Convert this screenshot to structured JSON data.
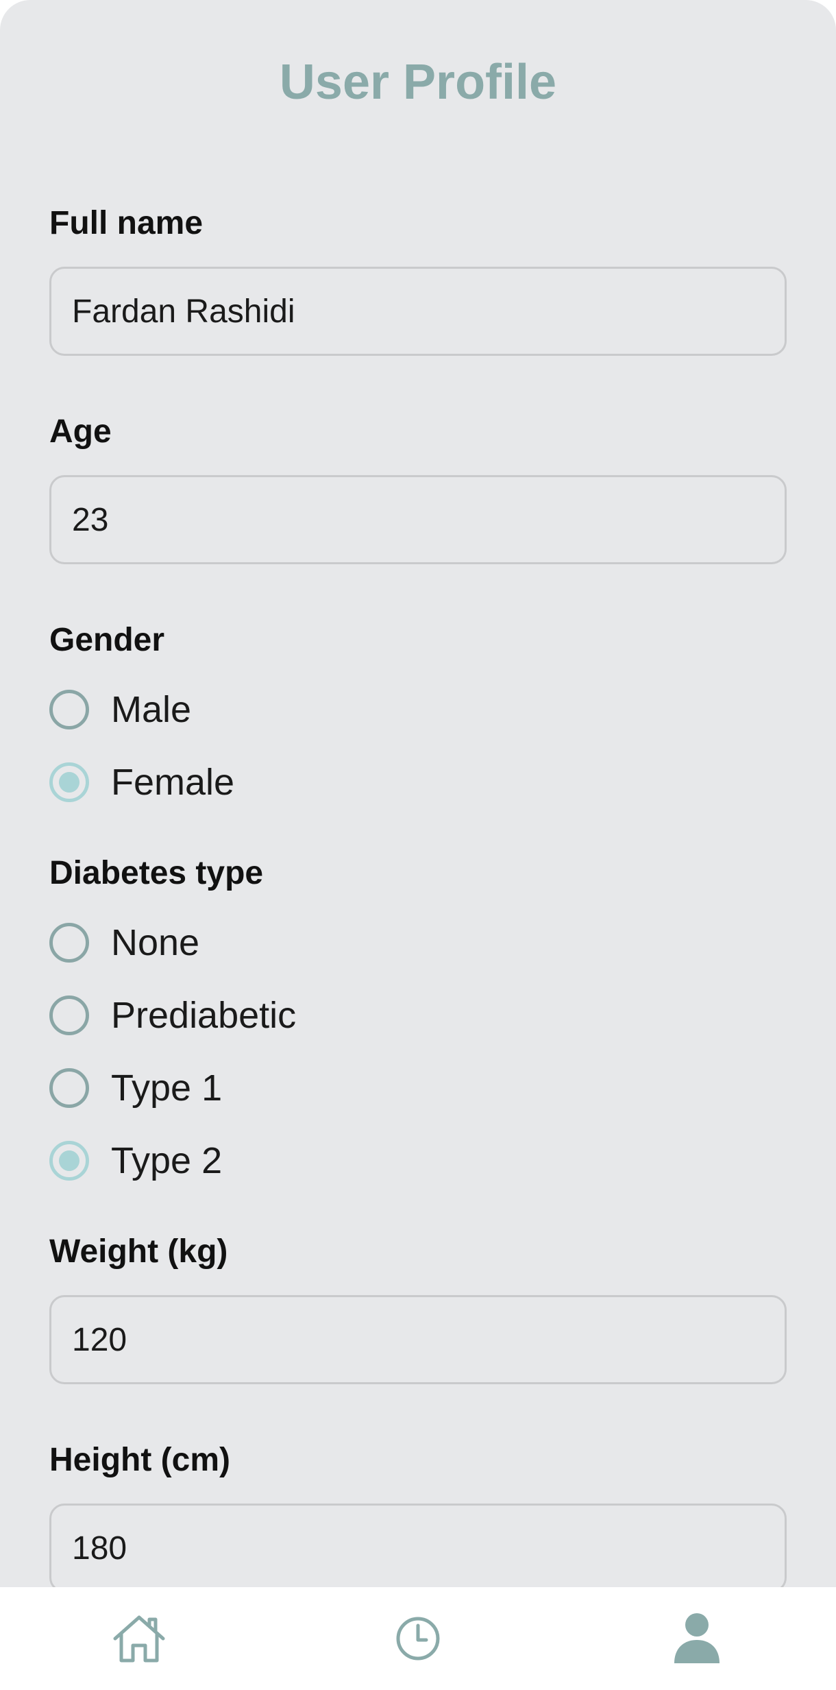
{
  "header": {
    "title": "User Profile"
  },
  "form": {
    "full_name": {
      "label": "Full name",
      "value": "Fardan Rashidi"
    },
    "age": {
      "label": "Age",
      "value": "23"
    },
    "gender": {
      "label": "Gender",
      "options": [
        {
          "label": "Male",
          "selected": false
        },
        {
          "label": "Female",
          "selected": true
        }
      ]
    },
    "diabetes_type": {
      "label": "Diabetes type",
      "options": [
        {
          "label": "None",
          "selected": false
        },
        {
          "label": "Prediabetic",
          "selected": false
        },
        {
          "label": "Type 1",
          "selected": false
        },
        {
          "label": "Type 2",
          "selected": true
        }
      ]
    },
    "weight": {
      "label": "Weight (kg)",
      "value": "120"
    },
    "height": {
      "label": "Height (cm)",
      "value": "180"
    }
  },
  "bottom_nav": {
    "items": [
      {
        "icon": "home-icon",
        "active": false
      },
      {
        "icon": "clock-icon",
        "active": false
      },
      {
        "icon": "person-icon",
        "active": true
      }
    ]
  },
  "colors": {
    "accent": "#8aaaa9",
    "radio_selected": "#a9d4d6",
    "background": "#e7e8ea"
  }
}
